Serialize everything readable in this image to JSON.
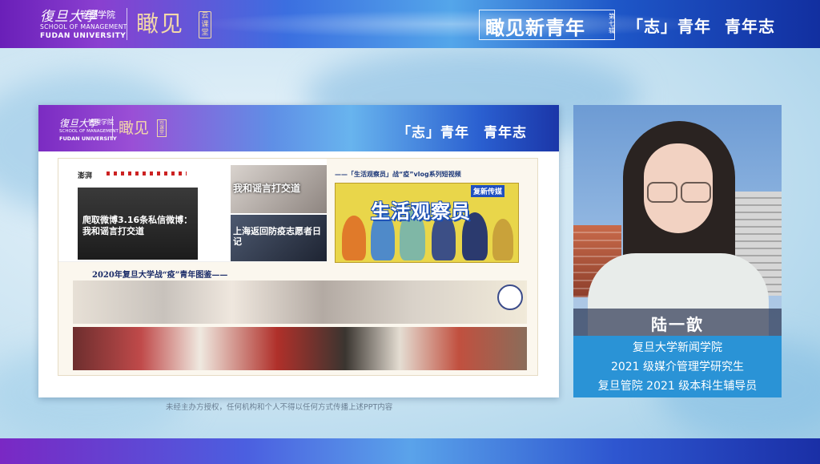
{
  "header": {
    "school_script": "復旦大學",
    "school_name_cn": "管理学院",
    "school_name_en1": "SCHOOL OF MANAGEMENT",
    "school_name_en2": "FUDAN UNIVERSITY",
    "brand": "瞰见",
    "brand_tag": "云课堂",
    "title": "瞰见新青年",
    "episode": "第七辑",
    "subtitle1": "「志」青年",
    "subtitle2": "青年志"
  },
  "slide": {
    "school_script": "復旦大學",
    "school_name_cn": "管理学院",
    "school_name_en1": "SCHOOL OF MANAGEMENT",
    "school_name_en2": "FUDAN UNIVERSITY",
    "brand": "瞰见",
    "brand_tag": "云课堂",
    "title": "「志」青年　青年志",
    "web_logo": "澎湃",
    "video_main_text": "爬取微博3.16条私信微博：我和谣言打交道",
    "video_small1_text": "我和谣言打交道",
    "video_small2_text": "上海返回防疫志愿者日记",
    "vlog_caption": "——「生活观察员」战“疫”vlog系列短视频",
    "vlog_badge": "复新传媒",
    "vlog_title": "生活观察员",
    "section2_title": "2020年复旦大学战“疫”青年图鉴——"
  },
  "footer_note": "未经主办方授权，任何机构和个人不得以任何方式传播上述PPT内容",
  "speaker": {
    "name": "陆一歆",
    "lines": [
      "复旦大学新闻学院",
      "2021 级媒介管理学研究生",
      "复旦管院 2021 级本科生辅导员"
    ]
  }
}
